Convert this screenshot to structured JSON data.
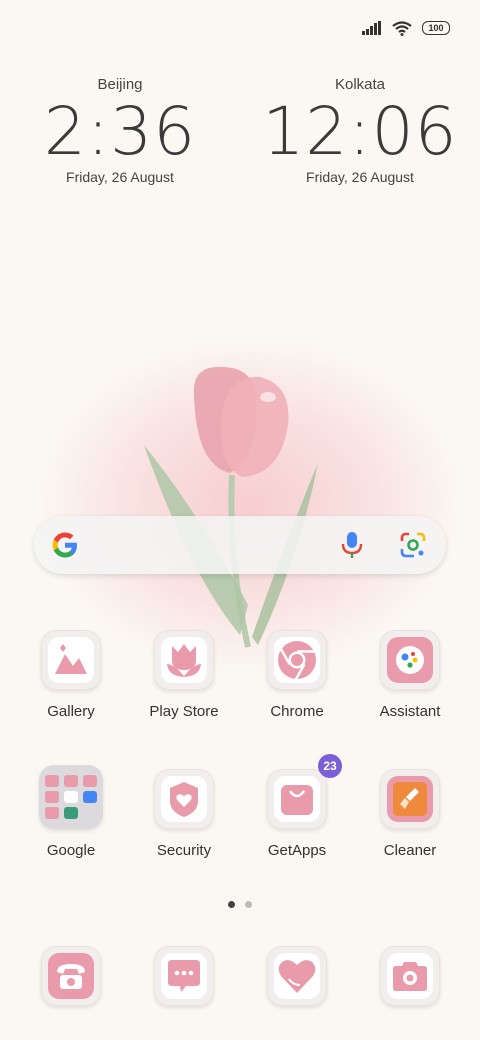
{
  "status_bar": {
    "battery": "100"
  },
  "clocks": [
    {
      "city": "Beijing",
      "time": "2:36",
      "date": "Friday, 26 August"
    },
    {
      "city": "Kolkata",
      "time": "12:06",
      "date": "Friday, 26 August"
    }
  ],
  "apps_row1": [
    {
      "label": "Gallery",
      "icon": "gallery-icon"
    },
    {
      "label": "Play Store",
      "icon": "play-store-icon"
    },
    {
      "label": "Chrome",
      "icon": "chrome-icon"
    },
    {
      "label": "Assistant",
      "icon": "assistant-icon"
    }
  ],
  "apps_row2": [
    {
      "label": "Google",
      "icon": "google-folder-icon"
    },
    {
      "label": "Security",
      "icon": "security-icon"
    },
    {
      "label": "GetApps",
      "icon": "getapps-icon",
      "badge": "23"
    },
    {
      "label": "Cleaner",
      "icon": "cleaner-icon"
    }
  ],
  "dock": [
    {
      "icon": "phone-icon"
    },
    {
      "icon": "messages-icon"
    },
    {
      "icon": "heart-app-icon"
    },
    {
      "icon": "camera-icon"
    }
  ],
  "page_indicator": {
    "pages": 2,
    "current": 1
  },
  "colors": {
    "accent_pink": "#e99aab",
    "badge": "#7b5fd6",
    "background": "#fbf8f3"
  }
}
